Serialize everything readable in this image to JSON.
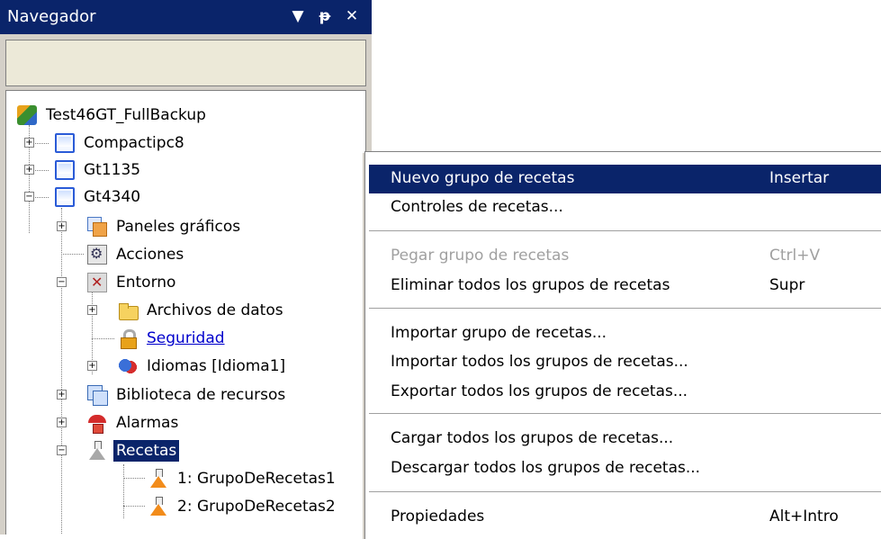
{
  "navigator": {
    "title": "Navegador",
    "buttons": {
      "dropdown": "▼",
      "pin": "ᵽ",
      "close": "✕"
    },
    "tree": {
      "root": "Test46GT_FullBackup",
      "devices": [
        "Compactipc8",
        "Gt1135",
        "Gt4340"
      ],
      "gt4340_children": {
        "paneles": "Paneles gráficos",
        "acciones": "Acciones",
        "entorno": "Entorno",
        "archivos": "Archivos de datos",
        "seguridad": "Seguridad",
        "idiomas": "Idiomas [Idioma1]",
        "biblioteca": "Biblioteca de recursos",
        "alarmas": "Alarmas",
        "recetas": "Recetas",
        "grupo1": "1: GrupoDeRecetas1",
        "grupo2": "2: GrupoDeRecetas2"
      }
    }
  },
  "context_menu": {
    "items": [
      {
        "label": "Nuevo grupo de recetas",
        "shortcut": "Insertar"
      },
      {
        "label": "Controles de recetas...",
        "shortcut": ""
      },
      {
        "label": "Pegar grupo de recetas",
        "shortcut": "Ctrl+V"
      },
      {
        "label": "Eliminar todos los grupos de recetas",
        "shortcut": "Supr"
      },
      {
        "label": "Importar grupo de recetas...",
        "shortcut": ""
      },
      {
        "label": "Importar todos los grupos de recetas...",
        "shortcut": ""
      },
      {
        "label": "Exportar todos los grupos de recetas...",
        "shortcut": ""
      },
      {
        "label": "Cargar todos los grupos de recetas...",
        "shortcut": ""
      },
      {
        "label": "Descargar todos los grupos de recetas...",
        "shortcut": ""
      },
      {
        "label": "Propiedades",
        "shortcut": "Alt+Intro"
      }
    ]
  }
}
